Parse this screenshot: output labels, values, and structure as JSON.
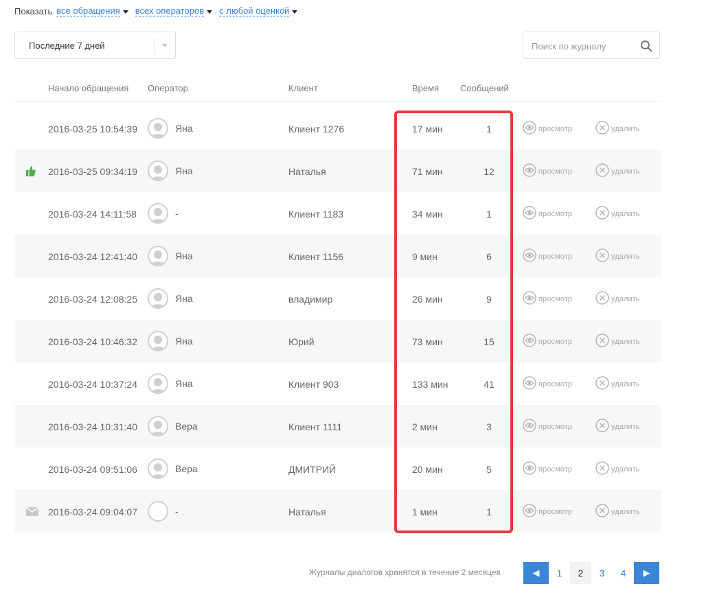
{
  "filters": {
    "label": "Показать",
    "request_filter": "все обращения",
    "operator_filter": "всех операторов",
    "rating_filter": "с любой оценкой"
  },
  "period_select": {
    "value": "Последние 7 дней"
  },
  "search": {
    "placeholder": "Поиск по журналу"
  },
  "columns": {
    "start": "Начало обращения",
    "operator": "Оператор",
    "client": "Клиент",
    "time": "Время",
    "messages": "Сообщений"
  },
  "actions": {
    "view": "просмотр",
    "delete": "удалить"
  },
  "rows": [
    {
      "date": "2016-03-25 10:54:39",
      "operator": "Яна",
      "client": "Клиент 1276",
      "time": "17 мин",
      "messages": "1",
      "mark": "",
      "avatar": "user"
    },
    {
      "date": "2016-03-25 09:34:19",
      "operator": "Яна",
      "client": "Наталья",
      "time": "71 мин",
      "messages": "12",
      "mark": "thumbs-up",
      "avatar": "user"
    },
    {
      "date": "2016-03-24 14:11:58",
      "operator": "-",
      "client": "Клиент 1183",
      "time": "34 мин",
      "messages": "1",
      "mark": "",
      "avatar": "user"
    },
    {
      "date": "2016-03-24 12:41:40",
      "operator": "Яна",
      "client": "Клиент 1156",
      "time": "9 мин",
      "messages": "6",
      "mark": "",
      "avatar": "user"
    },
    {
      "date": "2016-03-24 12:08:25",
      "operator": "Яна",
      "client": "владимир",
      "time": "26 мин",
      "messages": "9",
      "mark": "",
      "avatar": "user"
    },
    {
      "date": "2016-03-24 10:46:32",
      "operator": "Яна",
      "client": "Юрий",
      "time": "73 мин",
      "messages": "15",
      "mark": "",
      "avatar": "user"
    },
    {
      "date": "2016-03-24 10:37:24",
      "operator": "Яна",
      "client": "Клиент 903",
      "time": "133 мин",
      "messages": "41",
      "mark": "",
      "avatar": "user"
    },
    {
      "date": "2016-03-24 10:31:40",
      "operator": "Вера",
      "client": "Клиент 1111",
      "time": "2 мин",
      "messages": "3",
      "mark": "",
      "avatar": "user"
    },
    {
      "date": "2016-03-24 09:51:06",
      "operator": "Вера",
      "client": "ДМИТРИЙ",
      "time": "20 мин",
      "messages": "5",
      "mark": "",
      "avatar": "user"
    },
    {
      "date": "2016-03-24 09:04:07",
      "operator": "-",
      "client": "Наталья",
      "time": "1 мин",
      "messages": "1",
      "mark": "envelope",
      "avatar": "empty"
    }
  ],
  "footer": {
    "note": "Журналы диалогов хранятся в течение 2 месяцев",
    "prev": "◀",
    "next": "▶",
    "pages": [
      "1",
      "2",
      "3",
      "4"
    ],
    "current_page": "2"
  },
  "colors": {
    "accent": "#3b86d6",
    "highlight": "#e53b3b",
    "thumb": "#4caf50"
  }
}
